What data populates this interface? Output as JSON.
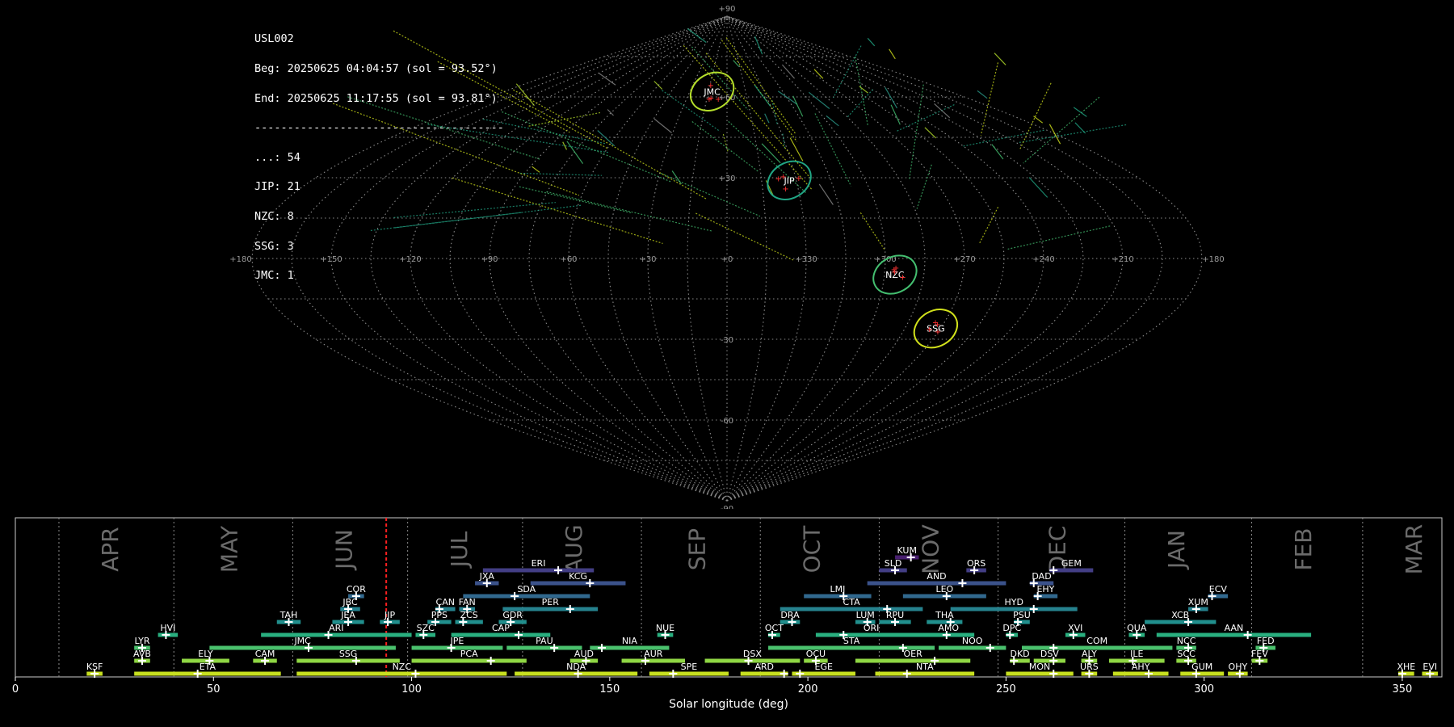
{
  "info": {
    "station": "USL002",
    "begin": "Beg: 20250625 04:04:57 (sol = 93.52°)",
    "end": "End: 20250625 11:17:55 (sol = 93.81°)",
    "separator": "--------------------------------------",
    "counts": [
      "...: 54",
      "JIP: 21",
      "NZC: 8",
      "SSG: 3",
      "JMC: 1"
    ]
  },
  "sky_map": {
    "projection": "sinusoidal",
    "lon_labels": [
      "+180",
      "+150",
      "+120",
      "+90",
      "+60",
      "+30",
      "+0",
      "+330",
      "+300",
      "+270",
      "+240",
      "+210",
      "+180"
    ],
    "lat_labels": [
      "+90",
      "+60",
      "+30",
      "-30",
      "-60",
      "-90"
    ],
    "radiants": [
      {
        "code": "JMC",
        "lon": -12,
        "lat": 62,
        "color": "#b5de2b"
      },
      {
        "code": "JIP",
        "lon": 27,
        "lat": 29,
        "color": "#21a685"
      },
      {
        "code": "NZC",
        "lon": 64,
        "lat": -6,
        "color": "#44bf70"
      },
      {
        "code": "SSG",
        "lon": 88,
        "lat": -26,
        "color": "#d2e21b"
      }
    ]
  },
  "chart_data": {
    "type": "timeline",
    "xlabel": "Solar longitude (deg)",
    "xlim": [
      0,
      360
    ],
    "xticks": [
      0,
      50,
      100,
      150,
      200,
      250,
      300,
      350
    ],
    "current_sol": 93.6,
    "months": [
      {
        "name": "APR",
        "start": 11,
        "label": 24
      },
      {
        "name": "MAY",
        "start": 40,
        "label": 54
      },
      {
        "name": "JUN",
        "start": 70,
        "label": 83
      },
      {
        "name": "JUL",
        "start": 99,
        "label": 112
      },
      {
        "name": "AUG",
        "start": 128,
        "label": 141
      },
      {
        "name": "SEP",
        "start": 158,
        "label": 172
      },
      {
        "name": "OCT",
        "start": 188,
        "label": 201
      },
      {
        "name": "NOV",
        "start": 218,
        "label": 231
      },
      {
        "name": "DEC",
        "start": 248,
        "label": 263
      },
      {
        "name": "JAN",
        "start": 280,
        "label": 293
      },
      {
        "name": "FEB",
        "start": 312,
        "label": 325
      },
      {
        "name": "MAR",
        "start": 340,
        "label": 353
      }
    ],
    "showers": [
      {
        "code": "KUM",
        "start": 222,
        "end": 228,
        "peak": 226,
        "row": 11
      },
      {
        "code": "ERI",
        "start": 118,
        "end": 146,
        "peak": 137,
        "row": 10
      },
      {
        "code": "SLD",
        "start": 218,
        "end": 225,
        "peak": 222,
        "row": 10
      },
      {
        "code": "ORS",
        "start": 240,
        "end": 245,
        "peak": 242,
        "row": 10
      },
      {
        "code": "GEM",
        "start": 261,
        "end": 272,
        "peak": 262,
        "row": 10
      },
      {
        "code": "JXA",
        "start": 116,
        "end": 122,
        "peak": 119,
        "row": 9
      },
      {
        "code": "KCG",
        "start": 130,
        "end": 154,
        "peak": 145,
        "row": 9
      },
      {
        "code": "AND",
        "start": 215,
        "end": 250,
        "peak": 239,
        "row": 9
      },
      {
        "code": "DAD",
        "start": 256,
        "end": 262,
        "peak": 257,
        "row": 9
      },
      {
        "code": "COR",
        "start": 84,
        "end": 88,
        "peak": 86,
        "row": 8
      },
      {
        "code": "SDA",
        "start": 113,
        "end": 145,
        "peak": 126,
        "row": 8
      },
      {
        "code": "LMI",
        "start": 199,
        "end": 216,
        "peak": 209,
        "row": 8
      },
      {
        "code": "LEO",
        "start": 224,
        "end": 245,
        "peak": 235,
        "row": 8
      },
      {
        "code": "EHY",
        "start": 257,
        "end": 263,
        "peak": 258,
        "row": 8
      },
      {
        "code": "ECV",
        "start": 301,
        "end": 306,
        "peak": 302,
        "row": 8
      },
      {
        "code": "JBC",
        "start": 82,
        "end": 87,
        "peak": 84,
        "row": 7
      },
      {
        "code": "CAN",
        "start": 106,
        "end": 111,
        "peak": 107,
        "row": 7
      },
      {
        "code": "FAN",
        "start": 112,
        "end": 116,
        "peak": 114,
        "row": 7
      },
      {
        "code": "PER",
        "start": 123,
        "end": 147,
        "peak": 140,
        "row": 7
      },
      {
        "code": "CTA",
        "start": 193,
        "end": 229,
        "peak": 220,
        "row": 7
      },
      {
        "code": "HYD",
        "start": 236,
        "end": 268,
        "peak": 257,
        "row": 7
      },
      {
        "code": "XUM",
        "start": 296,
        "end": 301,
        "peak": 298,
        "row": 7
      },
      {
        "code": "TAH",
        "start": 66,
        "end": 72,
        "peak": 69,
        "row": 6
      },
      {
        "code": "JEA",
        "start": 80,
        "end": 88,
        "peak": 84,
        "row": 6
      },
      {
        "code": "JIP",
        "start": 92,
        "end": 97,
        "peak": 94,
        "row": 6
      },
      {
        "code": "PPS",
        "start": 104,
        "end": 110,
        "peak": 106,
        "row": 6
      },
      {
        "code": "ZCS",
        "start": 111,
        "end": 118,
        "peak": 113,
        "row": 6
      },
      {
        "code": "GDR",
        "start": 122,
        "end": 129,
        "peak": 125,
        "row": 6
      },
      {
        "code": "DRA",
        "start": 193,
        "end": 198,
        "peak": 196,
        "row": 6
      },
      {
        "code": "LUM",
        "start": 212,
        "end": 217,
        "peak": 215,
        "row": 6
      },
      {
        "code": "RPU",
        "start": 218,
        "end": 226,
        "peak": 222,
        "row": 6
      },
      {
        "code": "THA",
        "start": 230,
        "end": 239,
        "peak": 236,
        "row": 6
      },
      {
        "code": "PSU",
        "start": 252,
        "end": 256,
        "peak": 253,
        "row": 6
      },
      {
        "code": "XCB",
        "start": 285,
        "end": 303,
        "peak": 296,
        "row": 6
      },
      {
        "code": "HVI",
        "start": 36,
        "end": 41,
        "peak": 38,
        "row": 5
      },
      {
        "code": "ARI",
        "start": 62,
        "end": 100,
        "peak": 79,
        "row": 5
      },
      {
        "code": "SZC",
        "start": 101,
        "end": 106,
        "peak": 103,
        "row": 5
      },
      {
        "code": "CAP",
        "start": 110,
        "end": 135,
        "peak": 127,
        "row": 5
      },
      {
        "code": "NUE",
        "start": 162,
        "end": 166,
        "peak": 164,
        "row": 5
      },
      {
        "code": "OCT",
        "start": 190,
        "end": 193,
        "peak": 191,
        "row": 5
      },
      {
        "code": "ORI",
        "start": 202,
        "end": 230,
        "peak": 209,
        "row": 5
      },
      {
        "code": "AMO",
        "start": 229,
        "end": 242,
        "peak": 235,
        "row": 5
      },
      {
        "code": "DPC",
        "start": 250,
        "end": 253,
        "peak": 251,
        "row": 5
      },
      {
        "code": "XVI",
        "start": 265,
        "end": 270,
        "peak": 267,
        "row": 5
      },
      {
        "code": "QUA",
        "start": 281,
        "end": 285,
        "peak": 283,
        "row": 5
      },
      {
        "code": "AAN",
        "start": 288,
        "end": 327,
        "peak": 311,
        "row": 5
      },
      {
        "code": "LYR",
        "start": 30,
        "end": 34,
        "peak": 32,
        "row": 4
      },
      {
        "code": "JMC",
        "start": 49,
        "end": 96,
        "peak": 74,
        "row": 4
      },
      {
        "code": "JPE",
        "start": 100,
        "end": 123,
        "peak": 110,
        "row": 4
      },
      {
        "code": "PAU",
        "start": 124,
        "end": 143,
        "peak": 136,
        "row": 4
      },
      {
        "code": "NIA",
        "start": 145,
        "end": 165,
        "peak": 148,
        "row": 4
      },
      {
        "code": "STA",
        "start": 190,
        "end": 232,
        "peak": 224,
        "row": 4
      },
      {
        "code": "NOO",
        "start": 233,
        "end": 250,
        "peak": 246,
        "row": 4
      },
      {
        "code": "COM",
        "start": 254,
        "end": 292,
        "peak": 262,
        "row": 4
      },
      {
        "code": "NCC",
        "start": 293,
        "end": 298,
        "peak": 296,
        "row": 4
      },
      {
        "code": "FED",
        "start": 313,
        "end": 318,
        "peak": 315,
        "row": 4
      },
      {
        "code": "AVB",
        "start": 30,
        "end": 34,
        "peak": 32,
        "row": 3
      },
      {
        "code": "ELY",
        "start": 42,
        "end": 54,
        "peak": 49,
        "row": 3
      },
      {
        "code": "CAM",
        "start": 60,
        "end": 66,
        "peak": 63,
        "row": 3
      },
      {
        "code": "SSG",
        "start": 71,
        "end": 97,
        "peak": 86,
        "row": 3
      },
      {
        "code": "PCA",
        "start": 100,
        "end": 129,
        "peak": 120,
        "row": 3
      },
      {
        "code": "AUD",
        "start": 140,
        "end": 147,
        "peak": 144,
        "row": 3
      },
      {
        "code": "AUR",
        "start": 153,
        "end": 169,
        "peak": 159,
        "row": 3
      },
      {
        "code": "DSX",
        "start": 174,
        "end": 198,
        "peak": 185,
        "row": 3
      },
      {
        "code": "OCU",
        "start": 199,
        "end": 205,
        "peak": 202,
        "row": 3
      },
      {
        "code": "OER",
        "start": 212,
        "end": 241,
        "peak": 232,
        "row": 3
      },
      {
        "code": "DKD",
        "start": 251,
        "end": 256,
        "peak": 252,
        "row": 3
      },
      {
        "code": "DSV",
        "start": 257,
        "end": 265,
        "peak": 262,
        "row": 3
      },
      {
        "code": "ALY",
        "start": 269,
        "end": 273,
        "peak": 271,
        "row": 3
      },
      {
        "code": "ILE",
        "start": 276,
        "end": 290,
        "peak": 282,
        "row": 3
      },
      {
        "code": "SCC",
        "start": 293,
        "end": 298,
        "peak": 296,
        "row": 3
      },
      {
        "code": "FEV",
        "start": 312,
        "end": 316,
        "peak": 314,
        "row": 3
      },
      {
        "code": "KSF",
        "start": 18,
        "end": 22,
        "peak": 20,
        "row": 2
      },
      {
        "code": "ETA",
        "start": 30,
        "end": 67,
        "peak": 46,
        "row": 2
      },
      {
        "code": "NZC",
        "start": 71,
        "end": 124,
        "peak": 101,
        "row": 2
      },
      {
        "code": "NDA",
        "start": 126,
        "end": 157,
        "peak": 142,
        "row": 2
      },
      {
        "code": "SPE",
        "start": 160,
        "end": 180,
        "peak": 166,
        "row": 2
      },
      {
        "code": "ARD",
        "start": 183,
        "end": 195,
        "peak": 194,
        "row": 2
      },
      {
        "code": "EGE",
        "start": 196,
        "end": 212,
        "peak": 198,
        "row": 2
      },
      {
        "code": "NTA",
        "start": 217,
        "end": 242,
        "peak": 225,
        "row": 2
      },
      {
        "code": "MON",
        "start": 250,
        "end": 267,
        "peak": 262,
        "row": 2
      },
      {
        "code": "URS",
        "start": 269,
        "end": 273,
        "peak": 271,
        "row": 2
      },
      {
        "code": "AHY",
        "start": 277,
        "end": 291,
        "peak": 286,
        "row": 2
      },
      {
        "code": "GUM",
        "start": 294,
        "end": 305,
        "peak": 298,
        "row": 2
      },
      {
        "code": "OHY",
        "start": 306,
        "end": 311,
        "peak": 309,
        "row": 2
      },
      {
        "code": "XHE",
        "start": 349,
        "end": 353,
        "peak": 350,
        "row": 2
      },
      {
        "code": "EVI",
        "start": 355,
        "end": 359,
        "peak": 357,
        "row": 2
      }
    ]
  }
}
